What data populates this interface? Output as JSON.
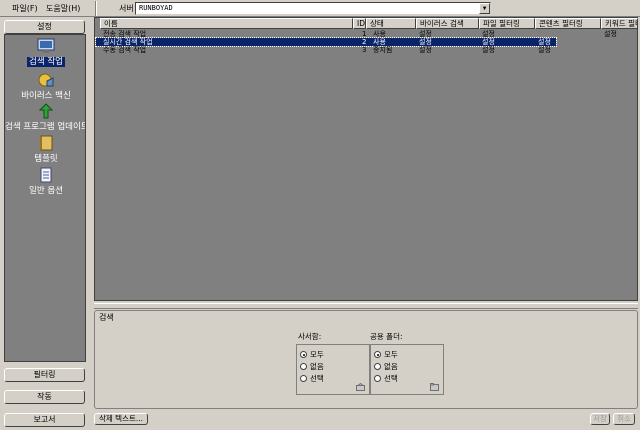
{
  "menu": {
    "file": "파일(F)",
    "help": "도움말(H)"
  },
  "server": {
    "label": "서버",
    "value": "RUNBOYAD"
  },
  "sidebar": {
    "top_button": "설정",
    "items": [
      {
        "label": "검색 작업",
        "icon": "search-job-icon"
      },
      {
        "label": "바이러스 백신",
        "icon": "antivirus-icon"
      },
      {
        "label": "검색 프로그램 업데이트",
        "icon": "update-icon"
      },
      {
        "label": "템플릿",
        "icon": "template-icon"
      },
      {
        "label": "일반 옵션",
        "icon": "options-icon"
      }
    ],
    "bottom_buttons": [
      "필터링",
      "작동",
      "보고서"
    ]
  },
  "table": {
    "columns": [
      "이름",
      "ID",
      "상태",
      "바이러스 검색",
      "파일 필터링",
      "콘텐츠 필터링",
      "키워드 필터링"
    ],
    "rows": [
      [
        "전송 검색 작업",
        "1",
        "사용",
        "설정",
        "설정",
        "",
        "설정"
      ],
      [
        "실시간 검색 작업",
        "2",
        "사용",
        "설정",
        "설정",
        "설정",
        ""
      ],
      [
        "수동 검색 작업",
        "3",
        "중지됨",
        "설정",
        "설정",
        "설정",
        ""
      ]
    ],
    "selected_row": 1
  },
  "search": {
    "title": "검색",
    "mailbox": {
      "label": "사서함:",
      "options": [
        "모두",
        "없음",
        "선택"
      ],
      "selected": 0
    },
    "public_folder": {
      "label": "공용 폴더:",
      "options": [
        "모두",
        "없음",
        "선택"
      ],
      "selected": 0
    }
  },
  "footer": {
    "delete_text": "삭제 텍스트...",
    "save": "저장",
    "cancel": "취소"
  }
}
